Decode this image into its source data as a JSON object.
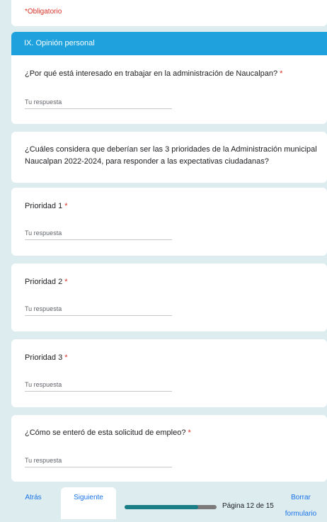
{
  "required_note": "*Obligatorio",
  "section": {
    "title": "IX. Opinión personal"
  },
  "questions": [
    {
      "text": "¿Por qué está interesado en trabajar en la administración de Naucalpan?",
      "required_mark": "*",
      "placeholder": "Tu respuesta"
    },
    {
      "text": "¿Cuáles considera que deberían ser las 3 prioridades de la Administración municipal Naucalpan 2022-2024, para responder a las expectativas ciudadanas?"
    },
    {
      "text": "Prioridad 1",
      "required_mark": "*",
      "placeholder": "Tu respuesta"
    },
    {
      "text": "Prioridad 2",
      "required_mark": "*",
      "placeholder": "Tu respuesta"
    },
    {
      "text": "Prioridad 3",
      "required_mark": "*",
      "placeholder": "Tu respuesta"
    },
    {
      "text": "¿Cómo se enteró de esta solicitud de empleo?",
      "required_mark": "*",
      "placeholder": "Tu respuesta"
    }
  ],
  "navigation": {
    "back_label": "Atrás",
    "next_label": "Siguiente",
    "page_label": "Página 12 de 15",
    "progress_fraction": 0.8,
    "clear_label_line1": "Borrar",
    "clear_label_line2": "formulario"
  },
  "colors": {
    "accent": "#1ea1dd",
    "progress_fill": "#1a7e86",
    "required": "#d93025",
    "background": "#dcecef"
  }
}
